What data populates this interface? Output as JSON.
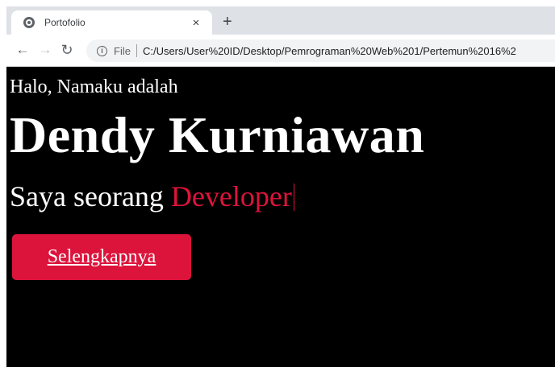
{
  "browser": {
    "tab": {
      "title": "Portofolio",
      "close_glyph": "×",
      "favicon": "globe-icon"
    },
    "new_tab_glyph": "+",
    "toolbar": {
      "back_glyph": "←",
      "forward_glyph": "→",
      "reload_glyph": "↻",
      "info_glyph": "i",
      "scheme_label": "File",
      "url": "C:/Users/User%20ID/Desktop/Pemrograman%20Web%201/Pertemun%2016%2"
    }
  },
  "page": {
    "greeting": "Halo, Namaku adalah",
    "name": "Dendy Kurniawan",
    "role_prefix": "Saya seorang",
    "role_highlight": "Developer",
    "cta_label": "Selengkapnya"
  },
  "colors": {
    "background": "#000000",
    "text": "#ffffff",
    "accent": "#dc143c"
  }
}
